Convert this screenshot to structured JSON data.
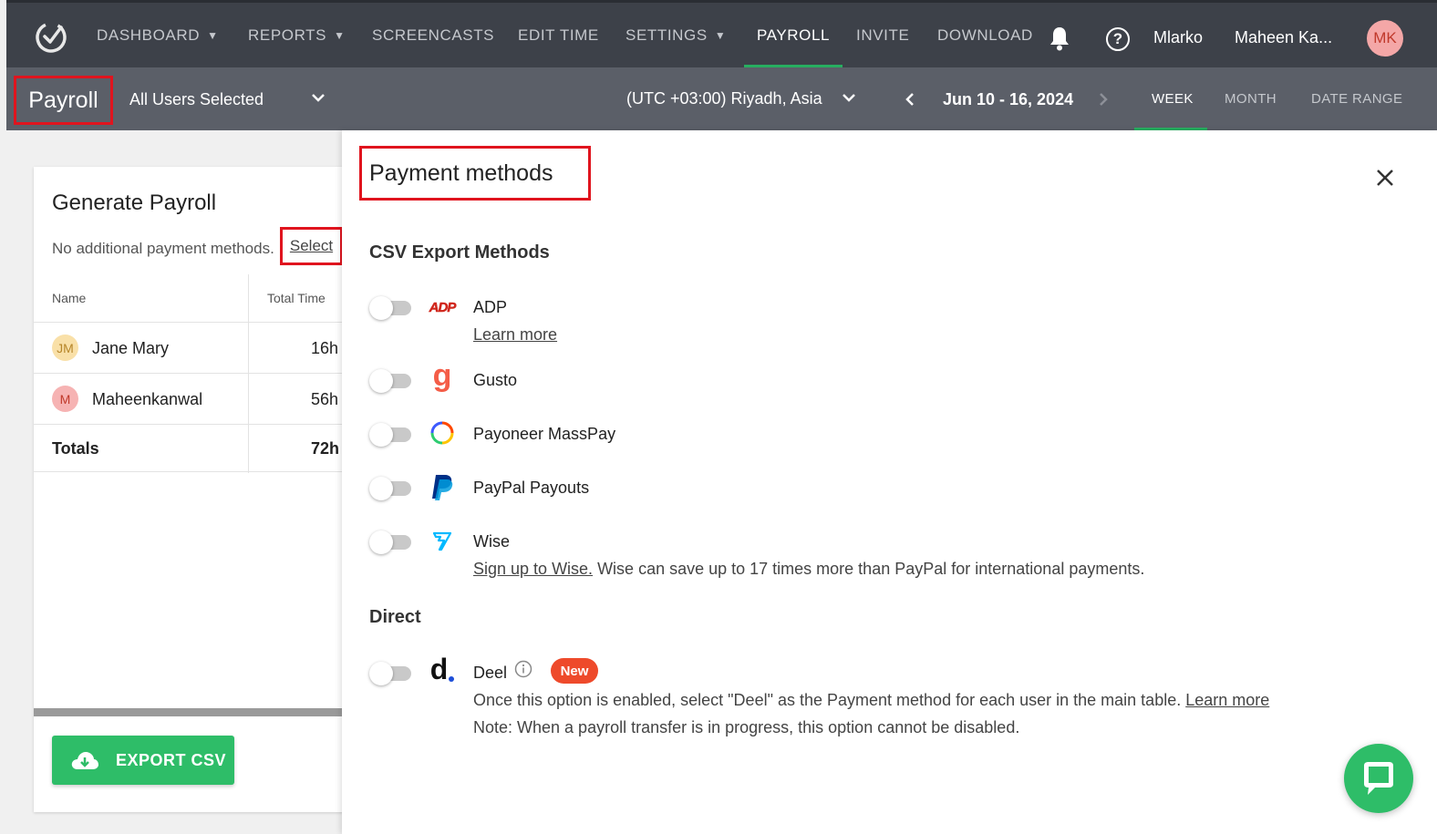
{
  "nav": {
    "items": [
      {
        "label": "DASHBOARD",
        "dropdown": true
      },
      {
        "label": "REPORTS",
        "dropdown": true
      },
      {
        "label": "SCREENCASTS",
        "dropdown": false
      },
      {
        "label": "EDIT TIME",
        "dropdown": false
      },
      {
        "label": "SETTINGS",
        "dropdown": true
      },
      {
        "label": "PAYROLL",
        "dropdown": false,
        "active": true
      },
      {
        "label": "INVITE",
        "dropdown": false
      },
      {
        "label": "DOWNLOAD",
        "dropdown": false
      }
    ],
    "org_name": "Mlarko",
    "user_name": "Maheen Ka...",
    "user_initials": "MK"
  },
  "subbar": {
    "page_title": "Payroll",
    "users_filter": "All Users Selected",
    "timezone": "(UTC +03:00) Riyadh, Asia",
    "date_range": "Jun 10 - 16, 2024",
    "range_tabs": [
      "WEEK",
      "MONTH",
      "DATE RANGE"
    ],
    "active_range_tab": "WEEK"
  },
  "generate": {
    "title": "Generate Payroll",
    "note": "No additional payment methods.",
    "select_link": "Select",
    "col_name": "Name",
    "col_time": "Total Time",
    "rows": [
      {
        "initials": "JM",
        "name": "Jane Mary",
        "time": "16h",
        "avatar_bg": "#f9e0a8",
        "avatar_fg": "#b7862a"
      },
      {
        "initials": "M",
        "name": "Maheenkanwal",
        "time": "56h",
        "avatar_bg": "#f6b3b3",
        "avatar_fg": "#c0392b"
      }
    ],
    "totals_label": "Totals",
    "totals_time": "72h",
    "export_label": "EXPORT CSV"
  },
  "panel": {
    "title": "Payment methods",
    "csv_section": "CSV Export Methods",
    "direct_section": "Direct",
    "adp": {
      "name": "ADP",
      "learn_more": "Learn more",
      "logo_text": "ADP"
    },
    "gusto": {
      "name": "Gusto",
      "logo_text": "g"
    },
    "payoneer": {
      "name": "Payoneer MassPay"
    },
    "paypal": {
      "name": "PayPal Payouts"
    },
    "wise": {
      "name": "Wise",
      "signup": "Sign up to Wise.",
      "desc": " Wise can save up to 17 times more than PayPal for international payments."
    },
    "deel": {
      "name": "Deel",
      "badge": "New",
      "logo_text": "d",
      "desc": "Once this option is enabled, select \"Deel\" as the Payment method for each user in the main table. ",
      "learn_more": "Learn more",
      "note": "Note: When a payroll transfer is in progress, this option cannot be disabled."
    }
  },
  "colors": {
    "accent_green": "#27ae60",
    "highlight_red": "#e0141e",
    "nav_bg": "#3d4149",
    "subbar_bg": "#5b5f68"
  }
}
